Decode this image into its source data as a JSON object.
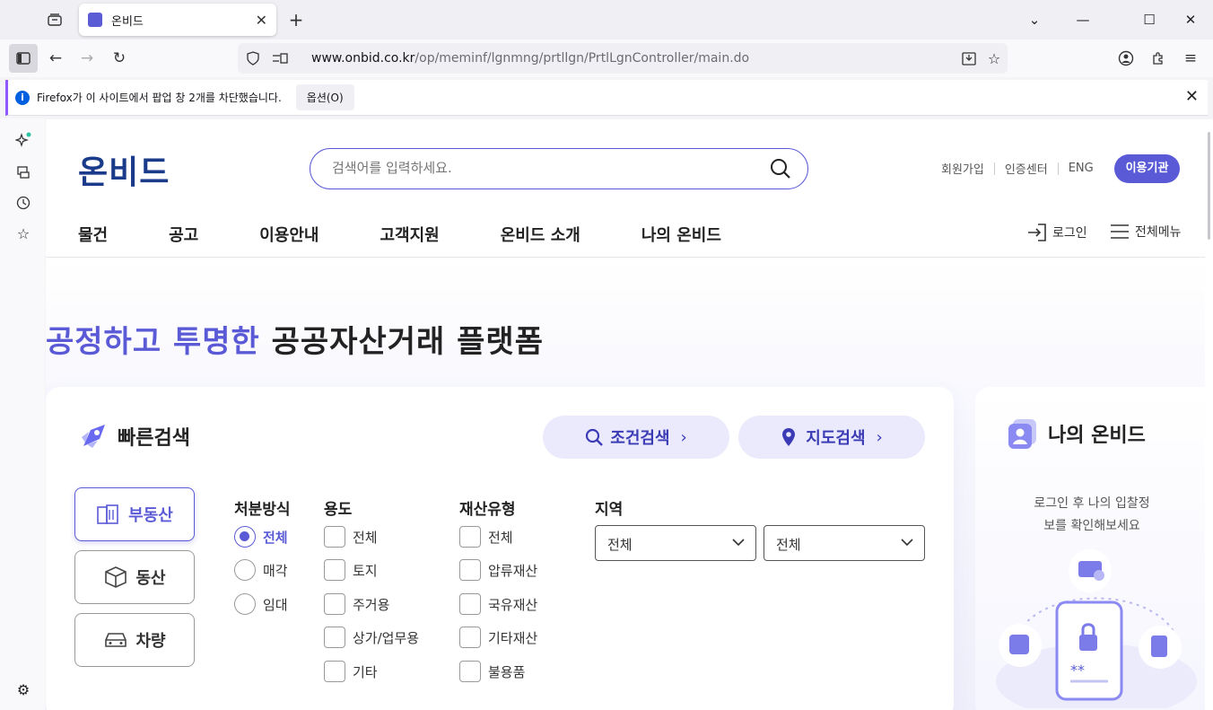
{
  "browser": {
    "tab_title": "온비드",
    "url_domain": "www.onbid.co.kr",
    "url_path": "/op/meminf/lgnmng/prtllgn/PrtlLgnController/main.do"
  },
  "notification": {
    "message": "Firefox가 이 사이트에서 팝업 창 2개를 차단했습니다.",
    "options_label": "옵션(O)"
  },
  "header": {
    "logo_text": "온비드",
    "search_placeholder": "검색어를 입력하세요.",
    "links": [
      "회원가입",
      "인증센터",
      "ENG"
    ],
    "agency_button": "이용기관",
    "login_label": "로그인",
    "all_menu_label": "전체메뉴"
  },
  "gnb": [
    "물건",
    "공고",
    "이용안내",
    "고객지원",
    "온비드 소개",
    "나의 온비드"
  ],
  "hero": {
    "headline_highlight": "공정하고 투명한",
    "headline_rest": "공공자산거래 플랫폼"
  },
  "quick_search": {
    "title": "빠른검색",
    "condition_search": "조건검색",
    "map_search": "지도검색",
    "categories": [
      "부동산",
      "동산",
      "차량"
    ],
    "disposal": {
      "title": "처분방식",
      "options": [
        "전체",
        "매각",
        "임대"
      ]
    },
    "usage": {
      "title": "용도",
      "options": [
        "전체",
        "토지",
        "주거용",
        "상가/업무용",
        "기타"
      ]
    },
    "asset_type": {
      "title": "재산유형",
      "options": [
        "전체",
        "압류재산",
        "국유재산",
        "기타재산",
        "불용품"
      ]
    },
    "region": {
      "title": "지역",
      "select1": "전체",
      "select2": "전체"
    }
  },
  "my_onbid": {
    "title": "나의 온비드",
    "desc_line1": "로그인 후 나의 입찰정",
    "desc_line2": "보를 확인해보세요"
  }
}
